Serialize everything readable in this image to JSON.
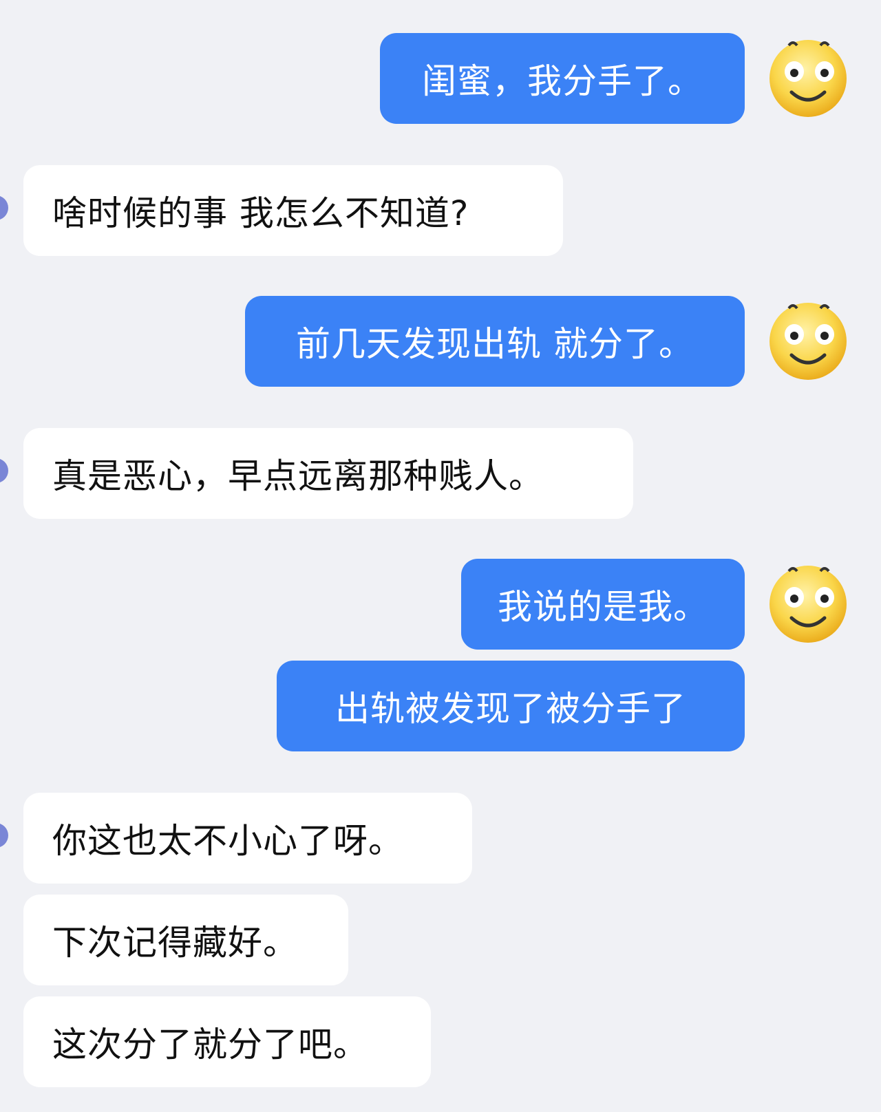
{
  "messages": [
    {
      "side": "out",
      "text": "闺蜜，我分手了。",
      "avatar": "smiley-face-emoji"
    },
    {
      "side": "in",
      "text": "啥时候的事 我怎么不知道?"
    },
    {
      "side": "out",
      "text": "前几天发现出轨 就分了。",
      "avatar": "smiley-face-emoji"
    },
    {
      "side": "in",
      "text": "真是恶心，早点远离那种贱人。"
    },
    {
      "side": "out",
      "text": "我说的是我。",
      "avatar": "smiley-face-emoji"
    },
    {
      "side": "out",
      "text": "出轨被发现了被分手了"
    },
    {
      "side": "in",
      "text": "你这也太不小心了呀。"
    },
    {
      "side": "in",
      "text": "下次记得藏好。"
    },
    {
      "side": "in",
      "text": "这次分了就分了吧。"
    }
  ],
  "colors": {
    "background": "#f0f1f5",
    "outgoing_bubble": "#3b82f6",
    "incoming_bubble": "#ffffff",
    "emoji_face": "#fad64a"
  }
}
